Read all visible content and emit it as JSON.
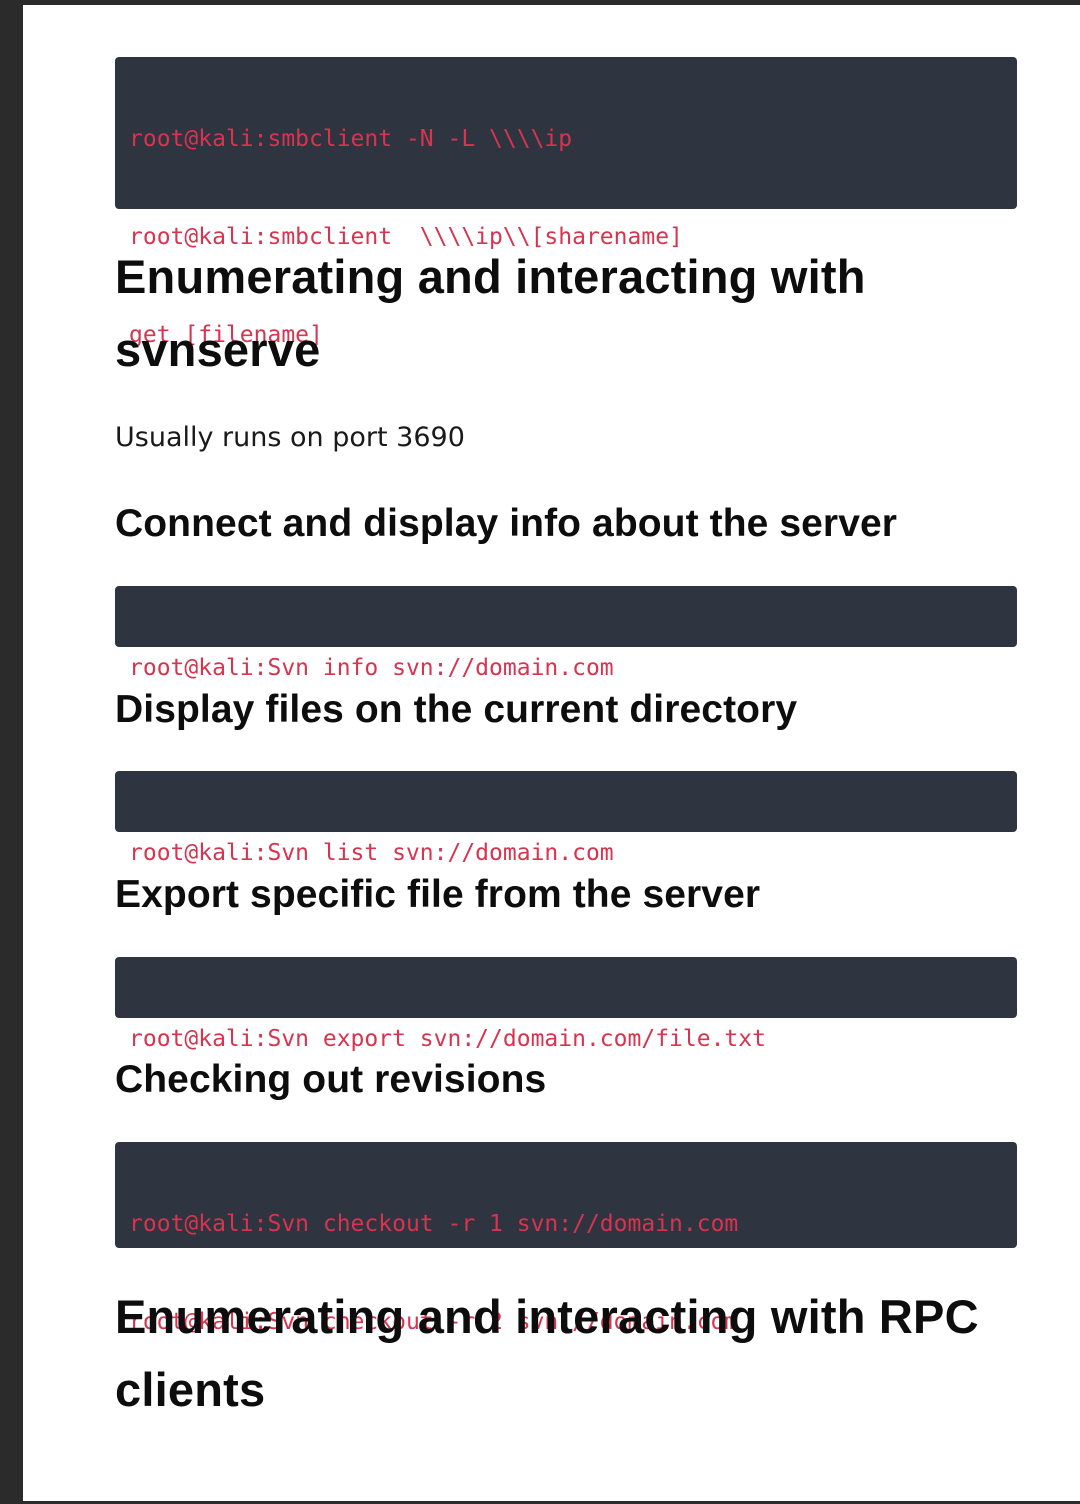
{
  "smb_block": {
    "lines": [
      "root@kali:smbclient -N -L \\\\\\\\ip",
      "root@kali:smbclient  \\\\\\\\ip\\\\[sharename]",
      "get [filename]"
    ]
  },
  "svn_section": {
    "heading": "Enumerating and interacting with svnserve",
    "port_note": "Usually runs on port 3690",
    "info": {
      "heading": "Connect and display info about the server",
      "command": "root@kali:Svn info svn://domain.com"
    },
    "list": {
      "heading": "Display files on the current directory",
      "command": "root@kali:Svn list svn://domain.com"
    },
    "export": {
      "heading": "Export specific file from the server",
      "command": "root@kali:Svn export svn://domain.com/file.txt"
    },
    "checkout": {
      "heading": "Checking out revisions",
      "commands": [
        "root@kali:Svn checkout -r 1 svn://domain.com",
        "root@kali:Svn checkout -r 2 svn://domain.com"
      ]
    }
  },
  "rpc_section": {
    "heading": "Enumerating and interacting with RPC clients"
  },
  "colors": {
    "code_background": "#2e3440",
    "code_text": "#d8334f",
    "heading_text": "#0d0d0d",
    "page_background": "#ffffff"
  }
}
